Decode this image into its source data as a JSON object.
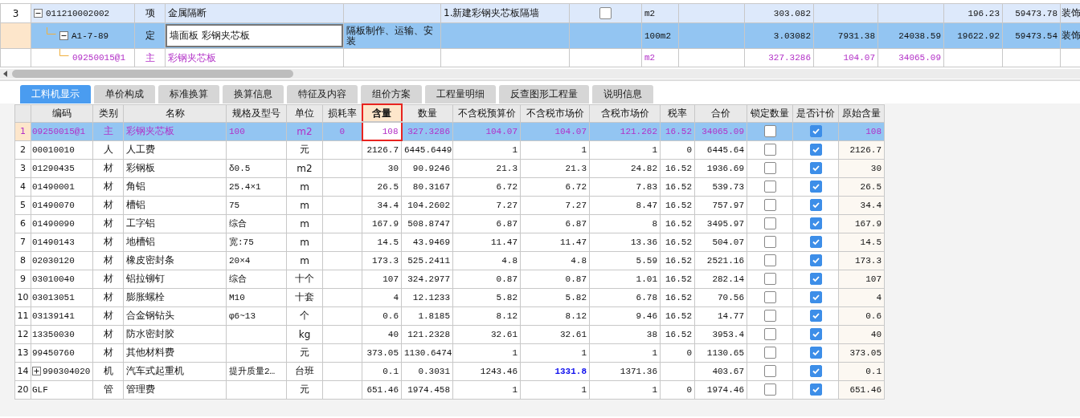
{
  "upper_grid": {
    "rows": [
      {
        "row_number": "3",
        "kind": "list_item",
        "selected": false,
        "editing": false,
        "expanded": true,
        "code": "011210002002",
        "type": "项",
        "name": "金属隔断",
        "column_6": "1.新建彩钢夹芯板隔墙",
        "column_7": {
          "checked": false
        },
        "unit": "m2",
        "column_10": "303.082",
        "column_13": "196.23",
        "column_14": "59473.78",
        "column_15": "装饰",
        "children": [
          {
            "kind": "quota",
            "selected": true,
            "editing": true,
            "expanded": true,
            "code": "A1-7-89",
            "type": "定",
            "name": "墙面板 彩钢夹芯板",
            "column_5": "隔板制作、运输、安装",
            "unit": "100m2",
            "column_10": "3.03082",
            "column_11": "7931.38",
            "column_12": "24038.59",
            "column_13": "19622.92",
            "column_14": "59473.54",
            "column_15": "装饰",
            "children": [
              {
                "kind": "material",
                "selected": false,
                "editing": false,
                "code": "09250015@1",
                "type": "主",
                "name": "彩钢夹芯板",
                "unit": "m2",
                "column_10": "327.3286",
                "column_11": "104.07",
                "column_12": "34065.09"
              }
            ]
          }
        ]
      }
    ]
  },
  "tabs": [
    {
      "label": "工料机显示",
      "selected": true
    },
    {
      "label": "单价构成",
      "selected": false
    },
    {
      "label": "标准换算",
      "selected": false
    },
    {
      "label": "换算信息",
      "selected": false
    },
    {
      "label": "特征及内容",
      "selected": false
    },
    {
      "label": "组价方案",
      "selected": false
    },
    {
      "label": "工程量明细",
      "selected": false
    },
    {
      "label": "反查图形工程量",
      "selected": false
    },
    {
      "label": "说明信息",
      "selected": false
    }
  ],
  "resource_grid": {
    "columns": [
      {
        "label": "编码",
        "selected": false
      },
      {
        "label": "类别",
        "selected": false
      },
      {
        "label": "名称",
        "selected": false
      },
      {
        "label": "规格及型号",
        "selected": false
      },
      {
        "label": "单位",
        "selected": false
      },
      {
        "label": "损耗率",
        "selected": false
      },
      {
        "label": "含量",
        "selected": true
      },
      {
        "label": "数量",
        "selected": false
      },
      {
        "label": "不含税预算价",
        "selected": false
      },
      {
        "label": "不含税市场价",
        "selected": false
      },
      {
        "label": "含税市场价",
        "selected": false
      },
      {
        "label": "税率",
        "selected": false
      },
      {
        "label": "合价",
        "selected": false
      },
      {
        "label": "锁定数量",
        "selected": false
      },
      {
        "label": "是否计价",
        "selected": false
      },
      {
        "label": "原始含量",
        "selected": false
      }
    ],
    "rows": [
      {
        "row_number": "1",
        "kind": "main_material",
        "selected": true,
        "code": "09250015@1",
        "type": "主",
        "name": "彩钢夹芯板",
        "spec": "100",
        "unit": "m2",
        "loss_rate": "0",
        "content": "108",
        "quantity": "327.3286",
        "budget_price": "104.07",
        "market_price": "104.07",
        "market_price_changed": false,
        "tax_market_price": "121.262",
        "tax_rate": "16.52",
        "total": "34065.09",
        "locked": false,
        "priced": true,
        "original_content": "108"
      },
      {
        "row_number": "2",
        "kind": "resource",
        "selected": false,
        "code": "00010010",
        "type": "人",
        "name": "人工费",
        "unit": "元",
        "content": "2126.7",
        "quantity": "6445.6449",
        "budget_price": "1",
        "market_price": "1",
        "market_price_changed": false,
        "tax_market_price": "1",
        "tax_rate": "0",
        "total": "6445.64",
        "locked": false,
        "priced": true,
        "original_content": "2126.7"
      },
      {
        "row_number": "3",
        "kind": "resource",
        "selected": false,
        "code": "01290435",
        "type": "材",
        "name": "彩钢板",
        "spec": "δ0.5",
        "unit": "m2",
        "content": "30",
        "quantity": "90.9246",
        "budget_price": "21.3",
        "market_price": "21.3",
        "market_price_changed": false,
        "tax_market_price": "24.82",
        "tax_rate": "16.52",
        "total": "1936.69",
        "locked": false,
        "priced": true,
        "original_content": "30"
      },
      {
        "row_number": "4",
        "kind": "resource",
        "selected": false,
        "code": "01490001",
        "type": "材",
        "name": "角铝",
        "spec": "25.4×1",
        "unit": "m",
        "content": "26.5",
        "quantity": "80.3167",
        "budget_price": "6.72",
        "market_price": "6.72",
        "market_price_changed": false,
        "tax_market_price": "7.83",
        "tax_rate": "16.52",
        "total": "539.73",
        "locked": false,
        "priced": true,
        "original_content": "26.5"
      },
      {
        "row_number": "5",
        "kind": "resource",
        "selected": false,
        "code": "01490070",
        "type": "材",
        "name": "槽铝",
        "spec": "75",
        "unit": "m",
        "content": "34.4",
        "quantity": "104.2602",
        "budget_price": "7.27",
        "market_price": "7.27",
        "market_price_changed": false,
        "tax_market_price": "8.47",
        "tax_rate": "16.52",
        "total": "757.97",
        "locked": false,
        "priced": true,
        "original_content": "34.4"
      },
      {
        "row_number": "6",
        "kind": "resource",
        "selected": false,
        "code": "01490090",
        "type": "材",
        "name": "工字铝",
        "spec": "综合",
        "unit": "m",
        "content": "167.9",
        "quantity": "508.8747",
        "budget_price": "6.87",
        "market_price": "6.87",
        "market_price_changed": false,
        "tax_market_price": "8",
        "tax_rate": "16.52",
        "total": "3495.97",
        "locked": false,
        "priced": true,
        "original_content": "167.9"
      },
      {
        "row_number": "7",
        "kind": "resource",
        "selected": false,
        "code": "01490143",
        "type": "材",
        "name": "地槽铝",
        "spec": "宽:75",
        "unit": "m",
        "content": "14.5",
        "quantity": "43.9469",
        "budget_price": "11.47",
        "market_price": "11.47",
        "market_price_changed": false,
        "tax_market_price": "13.36",
        "tax_rate": "16.52",
        "total": "504.07",
        "locked": false,
        "priced": true,
        "original_content": "14.5"
      },
      {
        "row_number": "8",
        "kind": "resource",
        "selected": false,
        "code": "02030120",
        "type": "材",
        "name": "橡皮密封条",
        "spec": "20×4",
        "unit": "m",
        "content": "173.3",
        "quantity": "525.2411",
        "budget_price": "4.8",
        "market_price": "4.8",
        "market_price_changed": false,
        "tax_market_price": "5.59",
        "tax_rate": "16.52",
        "total": "2521.16",
        "locked": false,
        "priced": true,
        "original_content": "173.3"
      },
      {
        "row_number": "9",
        "kind": "resource",
        "selected": false,
        "code": "03010040",
        "type": "材",
        "name": "铝拉铆钉",
        "spec": "综合",
        "unit": "十个",
        "content": "107",
        "quantity": "324.2977",
        "budget_price": "0.87",
        "market_price": "0.87",
        "market_price_changed": false,
        "tax_market_price": "1.01",
        "tax_rate": "16.52",
        "total": "282.14",
        "locked": false,
        "priced": true,
        "original_content": "107"
      },
      {
        "row_number": "10",
        "kind": "resource",
        "selected": false,
        "code": "03013051",
        "type": "材",
        "name": "膨胀螺栓",
        "spec": "M10",
        "unit": "十套",
        "content": "4",
        "quantity": "12.1233",
        "budget_price": "5.82",
        "market_price": "5.82",
        "market_price_changed": false,
        "tax_market_price": "6.78",
        "tax_rate": "16.52",
        "total": "70.56",
        "locked": false,
        "priced": true,
        "original_content": "4"
      },
      {
        "row_number": "11",
        "kind": "resource",
        "selected": false,
        "code": "03139141",
        "type": "材",
        "name": "合金钢钻头",
        "spec": "φ6~13",
        "unit": "个",
        "content": "0.6",
        "quantity": "1.8185",
        "budget_price": "8.12",
        "market_price": "8.12",
        "market_price_changed": false,
        "tax_market_price": "9.46",
        "tax_rate": "16.52",
        "total": "14.77",
        "locked": false,
        "priced": true,
        "original_content": "0.6"
      },
      {
        "row_number": "12",
        "kind": "resource",
        "selected": false,
        "code": "13350030",
        "type": "材",
        "name": "防水密封胶",
        "unit": "kg",
        "content": "40",
        "quantity": "121.2328",
        "budget_price": "32.61",
        "market_price": "32.61",
        "market_price_changed": false,
        "tax_market_price": "38",
        "tax_rate": "16.52",
        "total": "3953.4",
        "locked": false,
        "priced": true,
        "original_content": "40"
      },
      {
        "row_number": "13",
        "kind": "resource",
        "selected": false,
        "code": "99450760",
        "type": "材",
        "name": "其他材料费",
        "unit": "元",
        "content": "373.05",
        "quantity": "1130.6474",
        "budget_price": "1",
        "market_price": "1",
        "market_price_changed": false,
        "tax_market_price": "1",
        "tax_rate": "0",
        "total": "1130.65",
        "locked": false,
        "priced": true,
        "original_content": "373.05"
      },
      {
        "row_number": "14",
        "kind": "resource",
        "selected": false,
        "expanded": false,
        "code": "990304020",
        "type": "机",
        "name": "汽车式起重机",
        "spec": "提升质量2…",
        "unit": "台班",
        "content": "0.1",
        "quantity": "0.3031",
        "budget_price": "1243.46",
        "market_price": "1331.8",
        "market_price_changed": true,
        "tax_market_price": "1371.36",
        "total": "403.67",
        "locked": false,
        "priced": true,
        "original_content": "0.1"
      },
      {
        "row_number": "20",
        "kind": "resource",
        "selected": false,
        "code": "GLF",
        "type": "管",
        "name": "管理费",
        "unit": "元",
        "content": "651.46",
        "quantity": "1974.458",
        "budget_price": "1",
        "market_price": "1",
        "market_price_changed": false,
        "tax_market_price": "1",
        "tax_rate": "0",
        "total": "1974.46",
        "locked": false,
        "priced": true,
        "original_content": "651.46"
      }
    ]
  }
}
